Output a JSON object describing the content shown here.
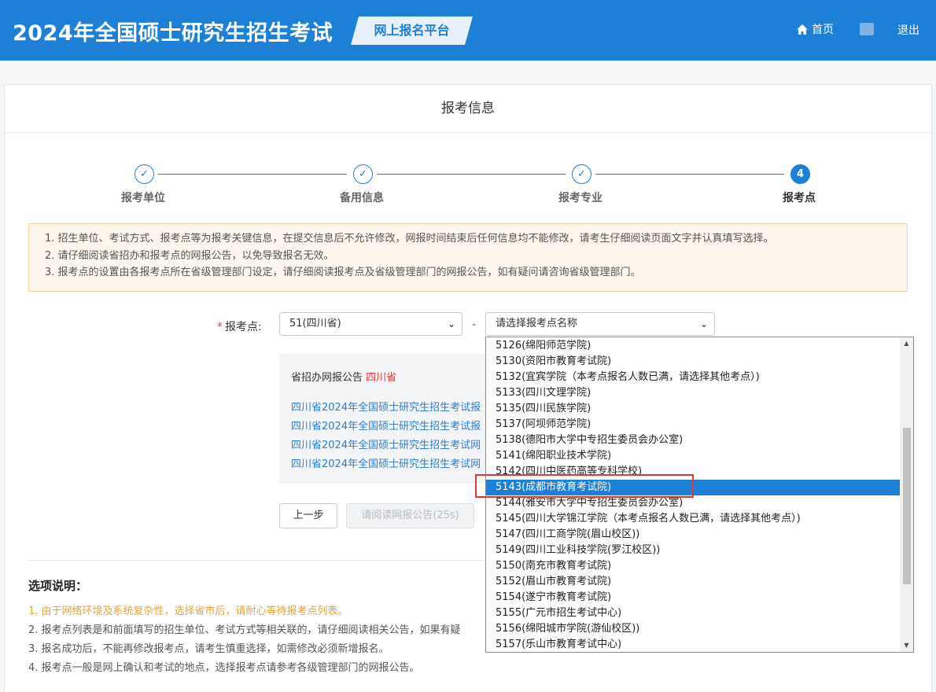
{
  "header": {
    "title": "2024年全国硕士研究生招生考试",
    "badge": "网上报名平台",
    "home_label": "首页",
    "logout_label": "退出"
  },
  "card": {
    "title": "报考信息"
  },
  "steps": [
    {
      "label": "报考单位",
      "mark": "✓",
      "done": true
    },
    {
      "label": "备用信息",
      "mark": "✓",
      "done": true
    },
    {
      "label": "报考专业",
      "mark": "✓",
      "done": true
    },
    {
      "label": "报考点",
      "mark": "4",
      "done": false
    }
  ],
  "notice": [
    "1. 招生单位、考试方式、报考点等为报考关键信息，在提交信息后不允许修改，网报时间结束后任何信息均不能修改，请考生仔细阅读页面文字并认真填写选择。",
    "2. 请仔细阅读省招办和报考点的网报公告，以免导致报名无效。",
    "3. 报考点的设置由各报考点所在省级管理部门设定，请仔细阅读报考点及省级管理部门的网报公告，如有疑问请咨询省级管理部门。"
  ],
  "form": {
    "label": "报考点:",
    "required_mark": "*",
    "province_select": "51(四川省)",
    "separator": "-",
    "site_select_placeholder": "请选择报考点名称"
  },
  "announcement": {
    "prefix": "省招办网报公告",
    "province": "四川省",
    "links": [
      "四川省2024年全国硕士研究生招生考试报",
      "四川省2024年全国硕士研究生招生考试报",
      "四川省2024年全国硕士研究生招生考试网",
      "四川省2024年全国硕士研究生招生考试网"
    ]
  },
  "buttons": {
    "prev": "上一步",
    "read_notice": "请阅读网报公告(25s)"
  },
  "help": {
    "title": "选项说明：",
    "items": [
      "1. 由于网络环境及系统复杂性，选择省市后，请耐心等待报考点列表。",
      "2. 报考点列表是和前面填写的招生单位、考试方式等相关联的，请仔细阅读相关公告，如果有疑",
      "3. 报名成功后，不能再修改报考点，请考生慎重选择，如需修改必须新增报名。",
      "4. 报考点一般是网上确认和考试的地点，选择报考点请参考各级管理部门的网报公告。"
    ]
  },
  "dropdown": {
    "selected_index": 9,
    "options": [
      "5126(绵阳师范学院)",
      "5130(资阳市教育考试院)",
      "5132(宜宾学院（本考点报名人数已满，请选择其他考点）)",
      "5133(四川文理学院)",
      "5135(四川民族学院)",
      "5137(阿坝师范学院)",
      "5138(德阳市大学中专招生委员会办公室)",
      "5141(绵阳职业技术学院)",
      "5142(四川中医药高等专科学校)",
      "5143(成都市教育考试院)",
      "5144(雅安市大学中专招生委员会办公室)",
      "5145(四川大学锦江学院（本考点报名人数已满，请选择其他考点）)",
      "5147(四川工商学院(眉山校区))",
      "5149(四川工业科技学院(罗江校区))",
      "5150(南充市教育考试院)",
      "5152(眉山市教育考试院)",
      "5154(遂宁市教育考试院)",
      "5155(广元市招生考试中心)",
      "5156(绵阳城市学院(游仙校区))",
      "5157(乐山市教育考试中心)"
    ]
  },
  "colors": {
    "primary": "#1e7fd6",
    "warning": "#e6a23c",
    "danger": "#e4393c",
    "highlight_box": "#e53935"
  }
}
